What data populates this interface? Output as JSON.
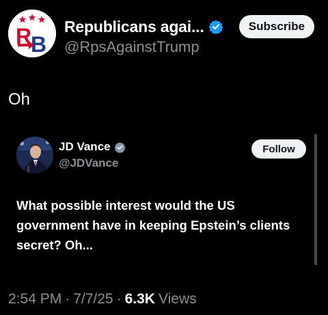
{
  "author": {
    "display_name": "Republicans agai...",
    "handle": "@RpsAgainstTrump",
    "avatar_icon": "rb-logo-icon",
    "verified_icon": "verified-badge-icon",
    "subscribe_label": "Subscribe"
  },
  "tweet": {
    "text": "Oh"
  },
  "quoted": {
    "display_name": "JD Vance",
    "handle": "@JDVance",
    "verified_icon": "verified-badge-gray-icon",
    "follow_label": "Follow",
    "text": "What possible interest would the US government have in keeping Epstein’s clients secret? Oh..."
  },
  "meta": {
    "time": "2:54 PM",
    "date": "7/7/25",
    "separator": "·",
    "views_count": "6.3K",
    "views_label": "Views"
  },
  "colors": {
    "background": "#000000",
    "secondary_text": "#8b8f94",
    "verified_blue": "#1d9bf0",
    "verified_gray": "#829aab",
    "button_bg": "#eff3f4"
  }
}
